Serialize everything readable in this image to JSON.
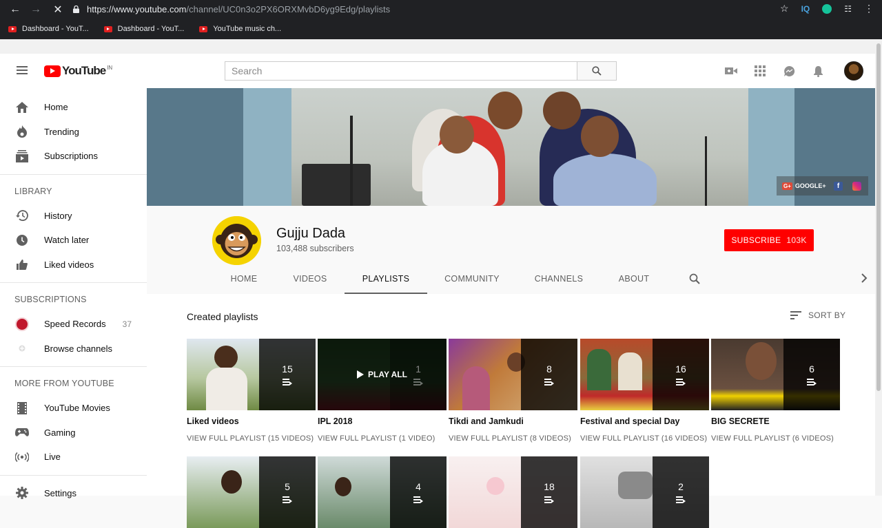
{
  "browser": {
    "url_host": "https://www.youtube.com",
    "url_path": "/channel/UC0n3o2PX6ORXMvbD6yg9Edg/playlists",
    "bookmarks": [
      {
        "label": "Dashboard - YouT..."
      },
      {
        "label": "Dashboard - YouT..."
      },
      {
        "label": "YouTube music ch..."
      }
    ],
    "ext_iq": "IQ"
  },
  "masthead": {
    "logo_text": "YouTube",
    "logo_region": "IN",
    "search_placeholder": "Search"
  },
  "sidebar": {
    "main": [
      {
        "label": "Home",
        "icon": "home-icon"
      },
      {
        "label": "Trending",
        "icon": "flame-icon"
      },
      {
        "label": "Subscriptions",
        "icon": "subscriptions-icon"
      }
    ],
    "library_heading": "LIBRARY",
    "library": [
      {
        "label": "History",
        "icon": "history-icon"
      },
      {
        "label": "Watch later",
        "icon": "clock-icon"
      },
      {
        "label": "Liked videos",
        "icon": "thumb-up-icon"
      }
    ],
    "subscriptions_heading": "SUBSCRIPTIONS",
    "subscriptions": [
      {
        "label": "Speed Records",
        "count": "37"
      },
      {
        "label": "Browse channels"
      }
    ],
    "more_heading": "MORE FROM YOUTUBE",
    "more": [
      {
        "label": "YouTube Movies",
        "icon": "film-icon"
      },
      {
        "label": "Gaming",
        "icon": "gamepad-icon"
      },
      {
        "label": "Live",
        "icon": "live-icon"
      }
    ],
    "settings_label": "Settings"
  },
  "banner": {
    "google_plus": "GOOGLE+",
    "gplus_badge": "G+",
    "fb_badge": "f"
  },
  "channel": {
    "name": "Gujju Dada",
    "subscribers": "103,488 subscribers",
    "subscribe_label": "SUBSCRIBE",
    "subscribe_count": "103K",
    "tabs": [
      "HOME",
      "VIDEOS",
      "PLAYLISTS",
      "COMMUNITY",
      "CHANNELS",
      "ABOUT"
    ],
    "active_tab": "PLAYLISTS"
  },
  "content": {
    "section_title": "Created playlists",
    "sort_label": "SORT BY",
    "playlists": [
      {
        "title": "Liked videos",
        "count": "15",
        "link": "VIEW FULL PLAYLIST (15 VIDEOS)"
      },
      {
        "title": "IPL 2018",
        "count": "1",
        "link": "VIEW FULL PLAYLIST (1 VIDEO)",
        "play_all": "PLAY ALL"
      },
      {
        "title": "Tikdi and Jamkudi",
        "count": "8",
        "link": "VIEW FULL PLAYLIST (8 VIDEOS)"
      },
      {
        "title": "Festival and special Day",
        "count": "16",
        "link": "VIEW FULL PLAYLIST (16 VIDEOS)"
      },
      {
        "title": "BIG SECRETE",
        "count": "6",
        "link": "VIEW FULL PLAYLIST (6 VIDEOS)"
      },
      {
        "count": "5"
      },
      {
        "count": "4"
      },
      {
        "count": "18"
      },
      {
        "count": "2"
      }
    ]
  },
  "colors": {
    "brand_red": "#ff0000",
    "chrome_dark": "#202124"
  }
}
